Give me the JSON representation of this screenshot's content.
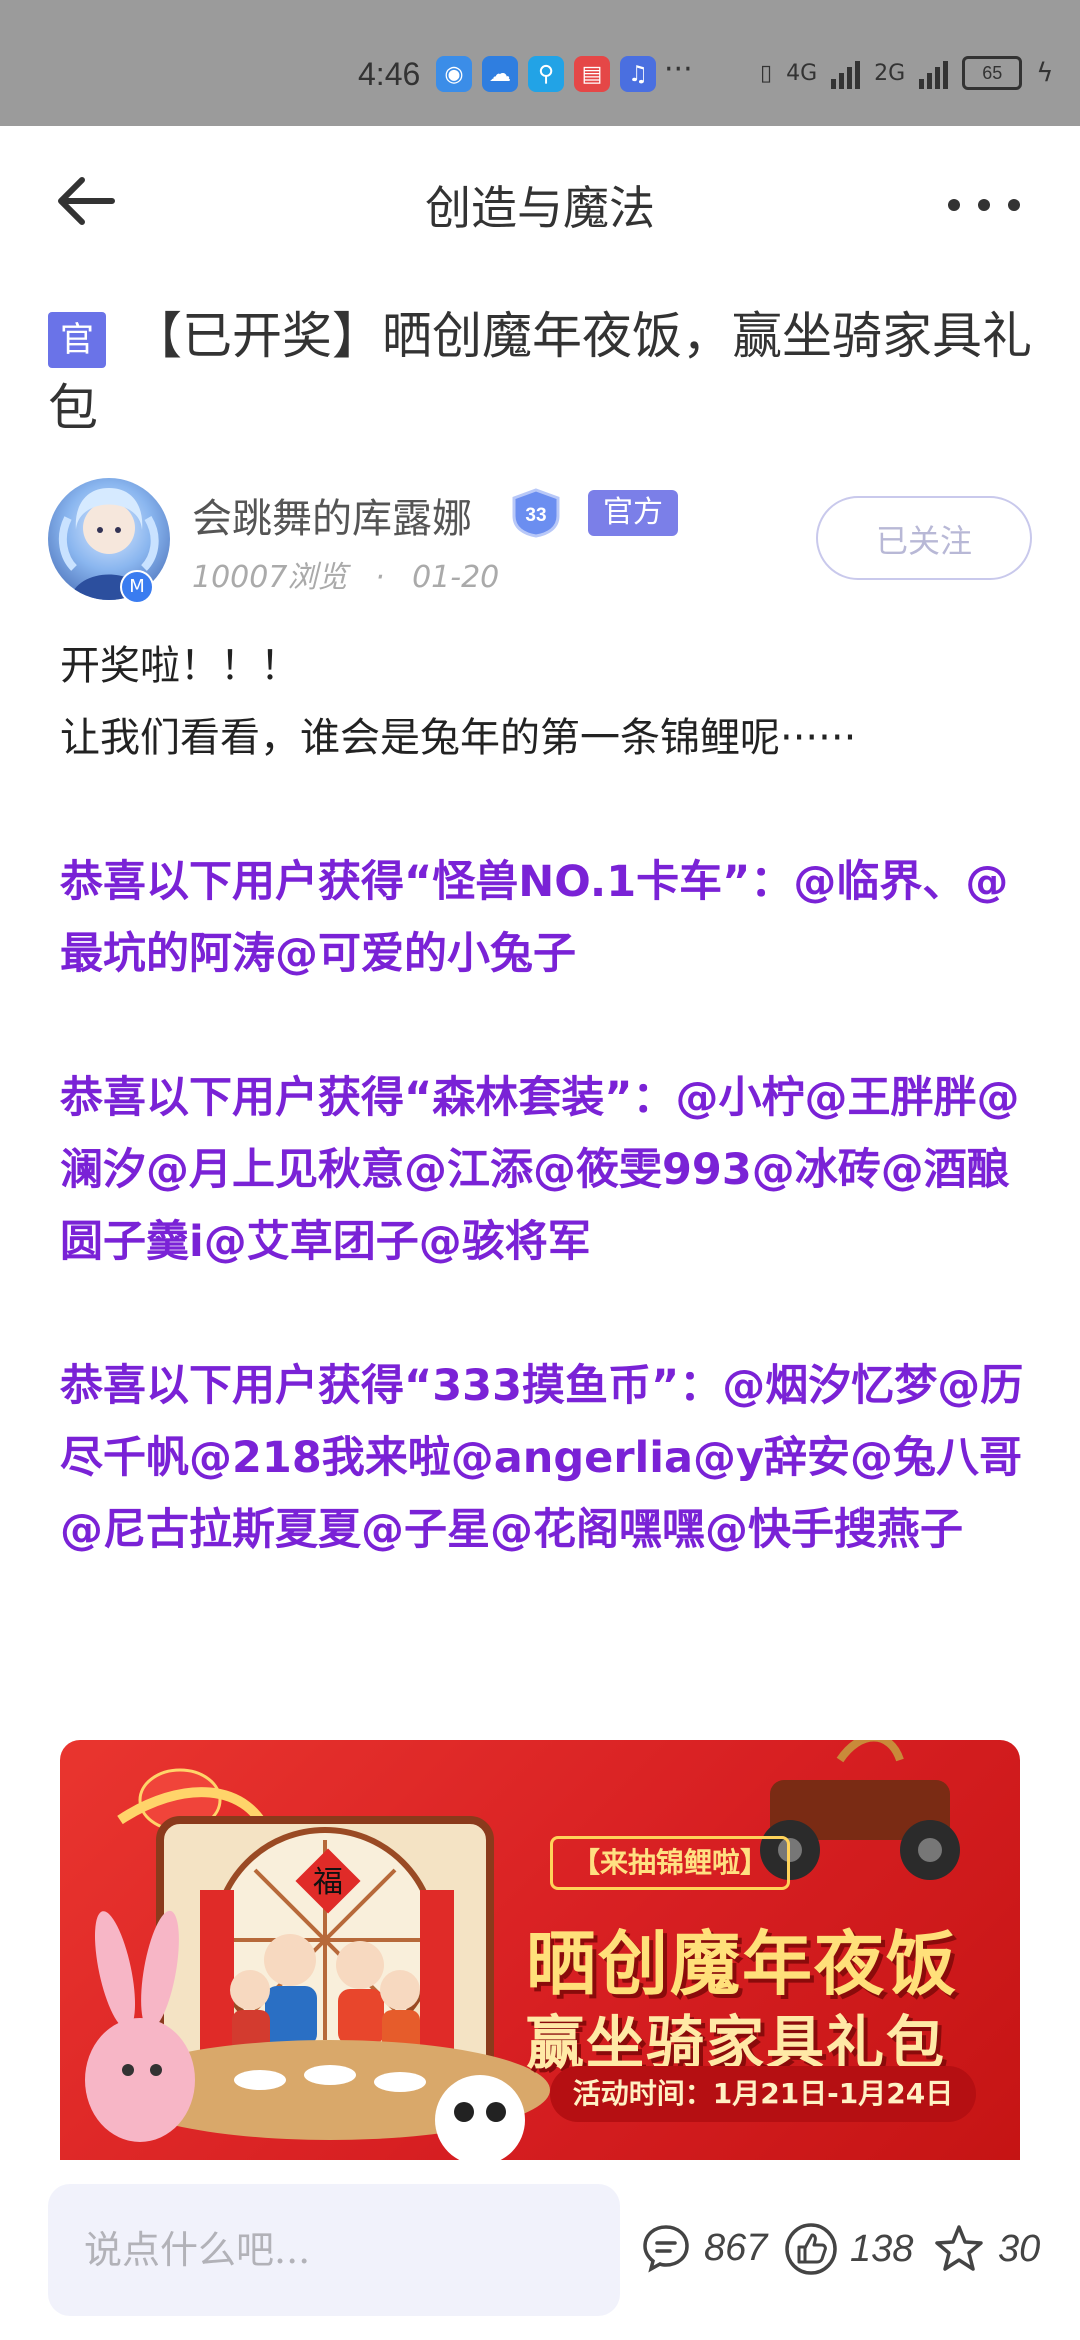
{
  "status_bar": {
    "time": "4:46",
    "network_1": "4G",
    "network_2": "2G",
    "battery": "65",
    "more": "···"
  },
  "header": {
    "title": "创造与魔法"
  },
  "post": {
    "tag": "官",
    "title": "【已开奖】晒创魔年夜饭，赢坐骑家具礼包",
    "author": {
      "name": "会跳舞的库露娜",
      "level": "33",
      "official_label": "官方",
      "views": "10007浏览",
      "separator": "·",
      "date": "01-20",
      "avatar_badge": "M"
    },
    "follow_label": "已关注",
    "body": {
      "line1": "开奖啦！！！",
      "line2": "让我们看看，谁会是兔年的第一条锦鲤呢······",
      "winner1": "恭喜以下用户获得“怪兽NO.1卡车”：@临界、@最坑的阿涛@可爱的小兔子",
      "winner2": "恭喜以下用户获得“森林套装”：@小柠@王胖胖@澜汐@月上见秋意@江添@筱雯993@冰砖@酒酿圆子羹i@艾草团子@骇将军",
      "winner3": "恭喜以下用户获得“333摸鱼币”：@烟汐忆梦@历尽千帆@218我来啦@angerlia@y辞安@兔八哥@尼古拉斯夏夏@子星@花阁嘿嘿@快手搜燕子"
    },
    "banner": {
      "tag": "【来抽锦鲤啦】",
      "headline": "晒创魔年夜饭",
      "subheadline": "赢坐骑家具礼包",
      "time": "活动时间：1月21日-1月24日",
      "fu": "福"
    }
  },
  "bottom_bar": {
    "comment_placeholder": "说点什么吧...",
    "comments": "867",
    "likes": "138",
    "favorites": "30"
  }
}
